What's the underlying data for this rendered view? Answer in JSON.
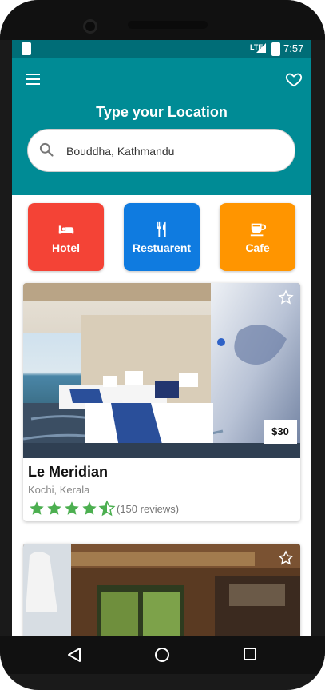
{
  "status_bar": {
    "network": "LTE",
    "time": "7:57"
  },
  "header": {
    "title": "Type your Location",
    "search": {
      "value": "Bouddha, Kathmandu",
      "placeholder": ""
    },
    "menu_icon": "menu-icon",
    "favorite_icon": "heart-icon",
    "background_color": "#008b95"
  },
  "categories": [
    {
      "label": "Hotel",
      "icon": "bed-icon",
      "color": "#f44336"
    },
    {
      "label": "Restuarent",
      "icon": "fork-knife-icon",
      "color": "#0f7be0"
    },
    {
      "label": "Cafe",
      "icon": "coffee-cup-icon",
      "color": "#ff9500"
    }
  ],
  "listings": [
    {
      "name": "Le Meridian",
      "location": "Kochi, Kerala",
      "price": "$30",
      "rating": 4.5,
      "reviews": "(150 reviews)"
    },
    {
      "name": "",
      "location": "",
      "price": "",
      "rating": null,
      "reviews": ""
    }
  ],
  "rating_color": "#4caf50",
  "nav": {
    "back_icon": "back-icon",
    "home_icon": "home-icon",
    "recents_icon": "recents-icon"
  }
}
